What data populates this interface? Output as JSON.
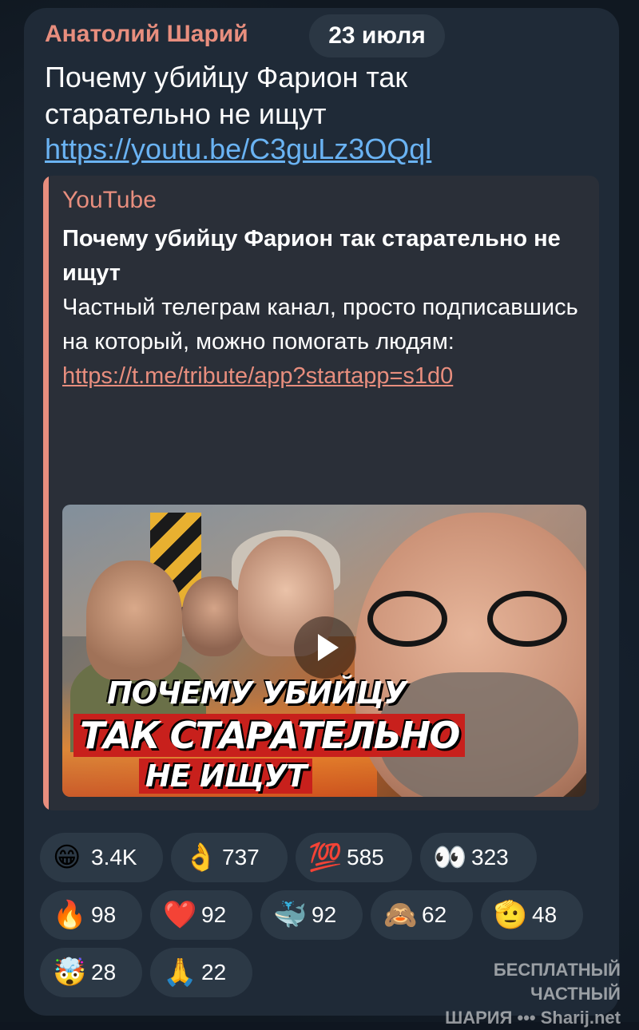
{
  "message": {
    "sender": "Анатолий Шарий",
    "date": "23 июля",
    "text": "Почему убийцу Фарион так старательно не ищут",
    "link": "https://youtu.be/C3guLz3OQql"
  },
  "preview": {
    "site": "YouTube",
    "title": "Почему убийцу Фарион так старательно не ищут",
    "description": "Частный телеграм канал, просто подписавшись на который, можно помогать людям: ",
    "description_link": "https://t.me/tribute/app?startapp=s1d0",
    "ellipsis": "...",
    "thumbnail": {
      "caption_1": "ПОЧЕМУ УБИЙЦУ",
      "caption_2": "ТАК СТАРАТЕЛЬНО",
      "caption_3": "НЕ ИЩУТ"
    }
  },
  "reactions": [
    {
      "emoji": "😁",
      "count": "3.4K"
    },
    {
      "emoji": "👌",
      "count": "737"
    },
    {
      "emoji": "💯",
      "count": "585"
    },
    {
      "emoji": "👀",
      "count": "323"
    },
    {
      "emoji": "🔥",
      "count": "98"
    },
    {
      "emoji": "❤️",
      "count": "92"
    },
    {
      "emoji": "🐳",
      "count": "92"
    },
    {
      "emoji": "🙈",
      "count": "62"
    },
    {
      "emoji": "🫡",
      "count": "48"
    },
    {
      "emoji": "🤯",
      "count": "28"
    },
    {
      "emoji": "🙏",
      "count": "22"
    }
  ],
  "watermark": {
    "line1": "БЕСПЛАТНЫЙ ЧАСТНЫЙ",
    "line2": "ШАРИЯ ••• Sharij.net"
  },
  "colors": {
    "accent": "#e88e7e",
    "link": "#6ab3f3",
    "bubble": "#1f2a37"
  }
}
